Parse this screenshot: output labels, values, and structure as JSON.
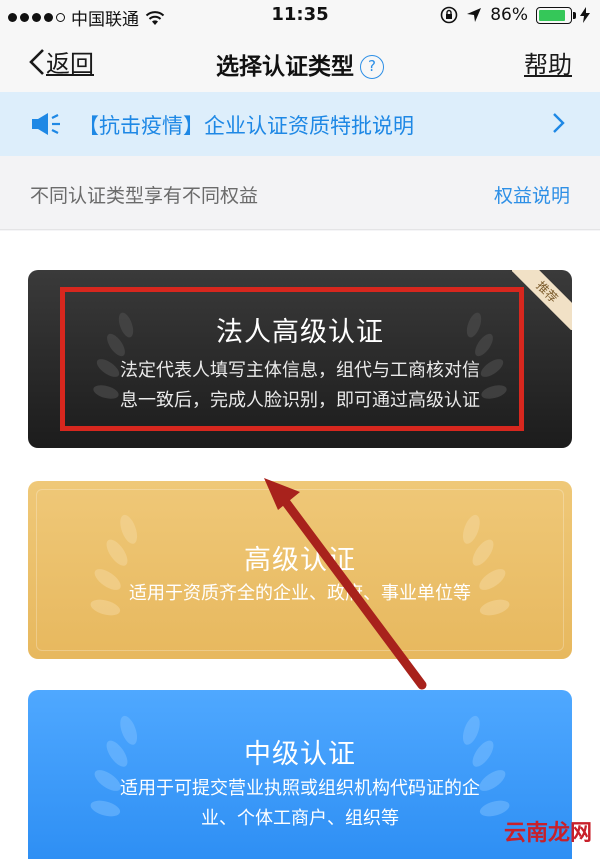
{
  "status_bar": {
    "carrier": "中国联通",
    "time": "11:35",
    "battery_percent": "86%",
    "battery_level": 0.86
  },
  "nav": {
    "back_label": "返回",
    "title": "选择认证类型",
    "help_symbol": "?",
    "help_label": "帮助"
  },
  "notice": {
    "text": "【抗击疫情】企业认证资质特批说明"
  },
  "subheader": {
    "left_text": "不同认证类型享有不同权益",
    "right_link": "权益说明"
  },
  "cards": [
    {
      "title": "法人高级认证",
      "desc_line1": "法定代表人填写主体信息，组代与工商核对信",
      "desc_line2": "息一致后，完成人脸识别，即可通过高级认证",
      "badge": "推荐"
    },
    {
      "title": "高级认证",
      "desc_line1": "适用于资质齐全的企业、政府、事业单位等"
    },
    {
      "title": "中级认证",
      "desc_line1": "适用于可提交营业执照或组织机构代码证的企",
      "desc_line2": "业、个体工商户、组织等"
    }
  ],
  "watermark": "云南龙网",
  "colors": {
    "accent": "#2d8fe6",
    "notice_bg": "#ddeefb",
    "highlight": "#d7271e",
    "gold": "#e9bd67",
    "blue": "#3b9af7"
  },
  "icons": [
    "wifi-icon",
    "location-arrow-icon",
    "orientation-lock-icon",
    "charging-icon",
    "back-chevron-icon",
    "question-icon",
    "speaker-icon",
    "chevron-right-icon",
    "laurel-icon",
    "red-arrow-annotation"
  ]
}
